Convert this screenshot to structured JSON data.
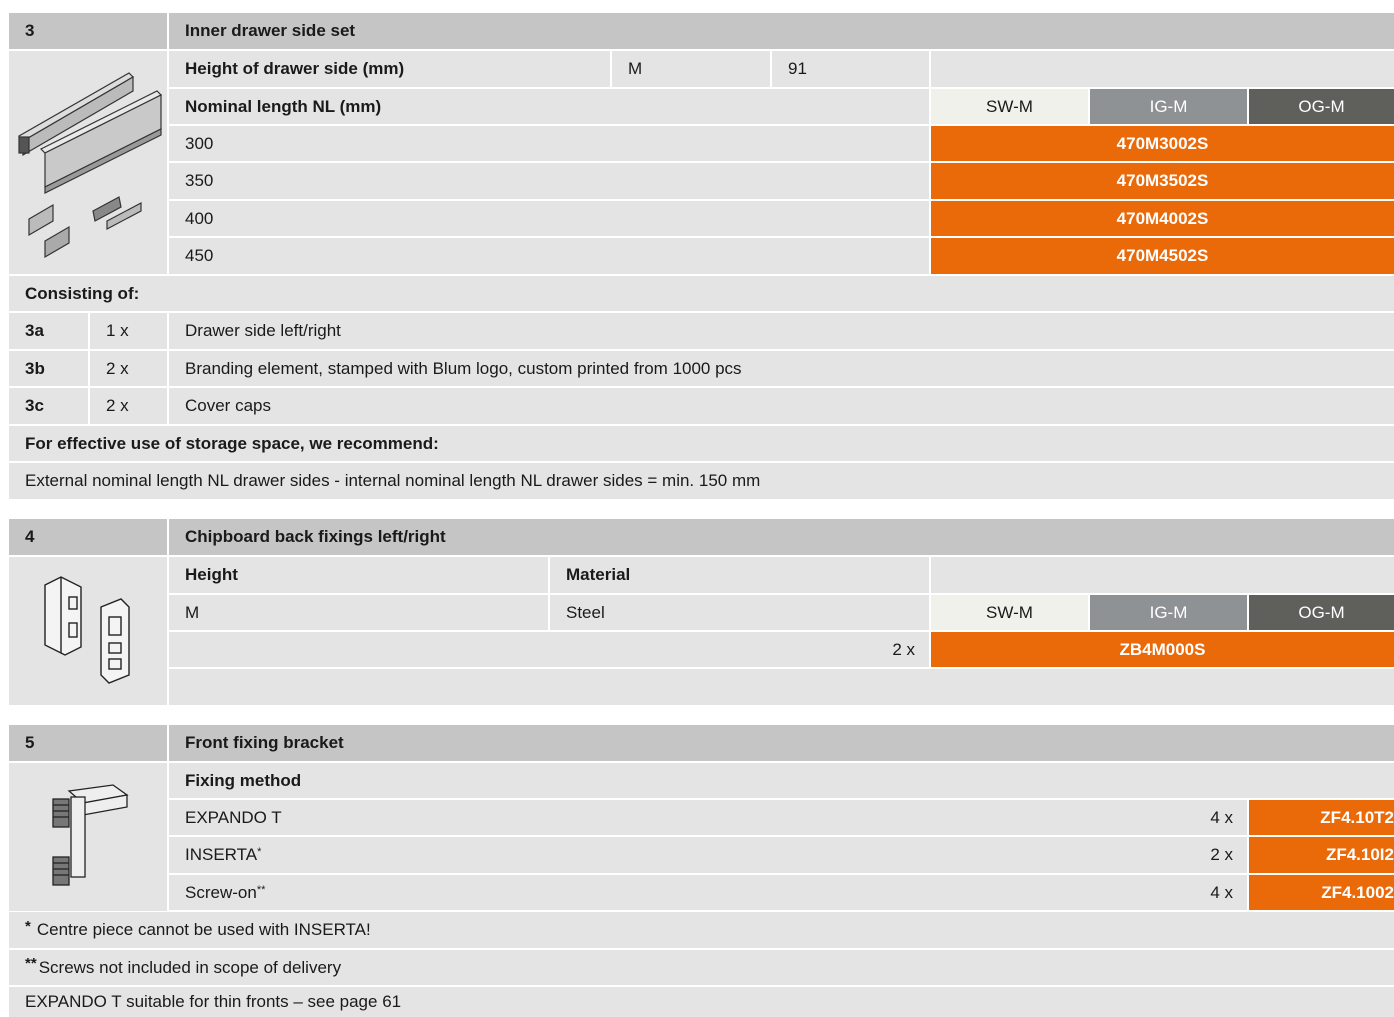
{
  "section3": {
    "number": "3",
    "title": "Inner drawer side set",
    "height_label": "Height of drawer side (mm)",
    "height_code": "M",
    "height_value": "91",
    "nl_label": "Nominal length NL (mm)",
    "colors": {
      "sw": "SW-M",
      "ig": "IG-M",
      "og": "OG-M"
    },
    "rows": [
      {
        "length": "300",
        "code": "470M3002S"
      },
      {
        "length": "350",
        "code": "470M3502S"
      },
      {
        "length": "400",
        "code": "470M4002S"
      },
      {
        "length": "450",
        "code": "470M4502S"
      }
    ],
    "consisting_label": "Consisting of:",
    "parts": [
      {
        "id": "3a",
        "qty": "1 x",
        "desc": "Drawer side left/right"
      },
      {
        "id": "3b",
        "qty": "2 x",
        "desc": "Branding element, stamped with Blum logo, custom printed from 1000 pcs"
      },
      {
        "id": "3c",
        "qty": "2 x",
        "desc": "Cover caps"
      }
    ],
    "recommend_label": "For effective use of storage space, we recommend:",
    "recommend_text": "External nominal length NL drawer sides - internal nominal length NL drawer sides = min. 150 mm"
  },
  "section4": {
    "number": "4",
    "title": "Chipboard back fixings left/right",
    "col_height": "Height",
    "col_material": "Material",
    "height_value": "M",
    "material_value": "Steel",
    "colors": {
      "sw": "SW-M",
      "ig": "IG-M",
      "og": "OG-M"
    },
    "qty": "2 x",
    "code": "ZB4M000S"
  },
  "section5": {
    "number": "5",
    "title": "Front fixing bracket",
    "method_label": "Fixing method",
    "rows": [
      {
        "method": "EXPANDO T",
        "sup": "",
        "qty": "4 x",
        "code": "ZF4.10T2"
      },
      {
        "method": "INSERTA",
        "sup": "*",
        "qty": "2 x",
        "code": "ZF4.10I2"
      },
      {
        "method": "Screw-on",
        "sup": "**",
        "qty": "4 x",
        "code": "ZF4.1002"
      }
    ],
    "notes": [
      {
        "mark": "*",
        "text": "Centre piece cannot be used with INSERTA!"
      },
      {
        "mark": "**",
        "text": "Screws not included in scope of delivery"
      },
      {
        "mark": "",
        "text": "EXPANDO T suitable for thin fronts – see page 61"
      }
    ]
  },
  "palette": {
    "header": "#c5c5c5",
    "row": "#e4e4e4",
    "orange": "#ea6a0a",
    "sw": "#f1f1ec",
    "ig": "#8f9294",
    "og": "#5f605c"
  }
}
